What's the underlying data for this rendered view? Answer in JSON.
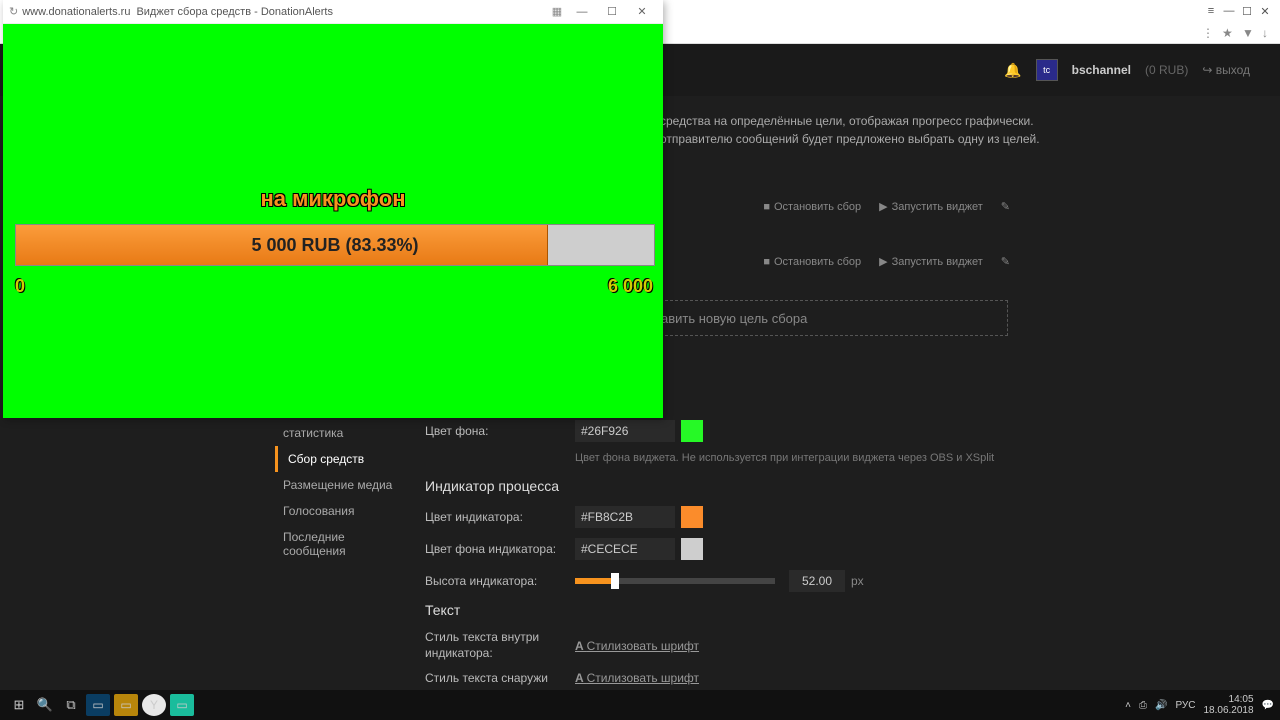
{
  "browser": {
    "min": "—",
    "max": "☐",
    "close": "✕",
    "menu": "≡"
  },
  "header": {
    "username": "bschannel",
    "balance": "(0 RUB)",
    "logout": "↪ выход"
  },
  "desc": {
    "line1": "средства на определённые цели, отображая прогресс графически.",
    "line2": "отправителю сообщений будет предложено выбрать одну из целей."
  },
  "goal_controls": {
    "stop": "Остановить сбор",
    "launch": "Запустить виджет"
  },
  "add_goal": "авить новую цель сбора",
  "sidebar": {
    "stats": "статистика",
    "collection": "Сбор средств",
    "media": "Размещение медиа",
    "voting": "Голосования",
    "messages": "Последние сообщения"
  },
  "settings": {
    "bgcolor_label": "Цвет фона:",
    "bgcolor": "#26F926",
    "bgcolor_hint": "Цвет фона виджета. Не используется при интеграции виджета через OBS и XSplit",
    "indicator_h": "Индикатор процесса",
    "ind_color_label": "Цвет индикатора:",
    "ind_color": "#FB8C2B",
    "ind_bg_label": "Цвет фона индикатора:",
    "ind_bg": "#CECECE",
    "height_label": "Высота индикатора:",
    "height": "52.00",
    "px": "px",
    "text_h": "Текст",
    "inner_style_label": "Стиль текста внутри индикатора:",
    "outer_style_label": "Стиль текста снаружи",
    "style_link": "Стилизовать шрифт"
  },
  "popup": {
    "url": "www.donationalerts.ru",
    "title": "Виджет сбора средств - DonationAlerts",
    "goal_title": "на микрофон",
    "progress_text": "5 000 RUB (83.33%)",
    "progress_pct": 83.33,
    "min": "0",
    "max": "6 000"
  },
  "taskbar": {
    "lang": "РУС",
    "time": "14:05",
    "date": "18.06.2018"
  }
}
